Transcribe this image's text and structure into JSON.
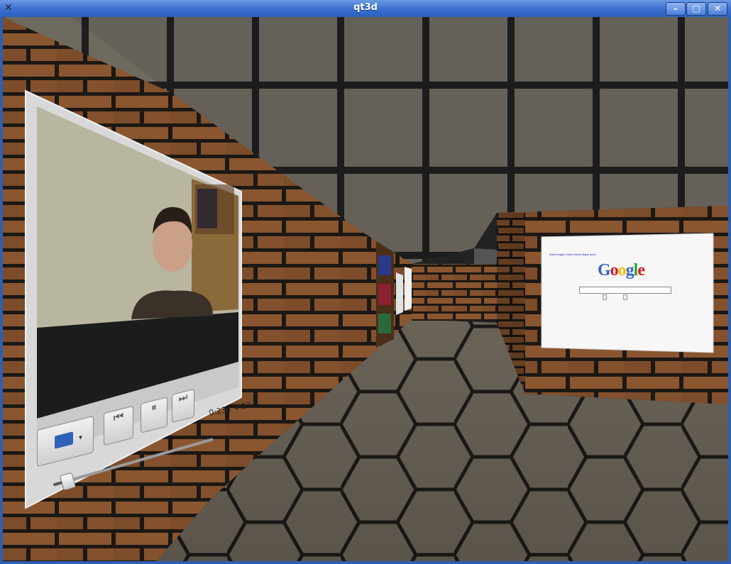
{
  "window": {
    "title": "qt3d",
    "minimize_symbol": "–",
    "maximize_symbol": "□",
    "close_symbol": "✕",
    "app_icon": "x-icon"
  },
  "player": {
    "time": "0:23 / 4:23",
    "progress": 0.087,
    "buttons": [
      "folder-icon",
      "skip-back-icon",
      "pause-icon",
      "skip-forward-icon"
    ]
  },
  "google_page": {
    "logo_text": "Google",
    "logo_colors": [
      "#3366cc",
      "#cc2222",
      "#ffbb00",
      "#3366cc",
      "#22aa33",
      "#cc2222"
    ]
  }
}
